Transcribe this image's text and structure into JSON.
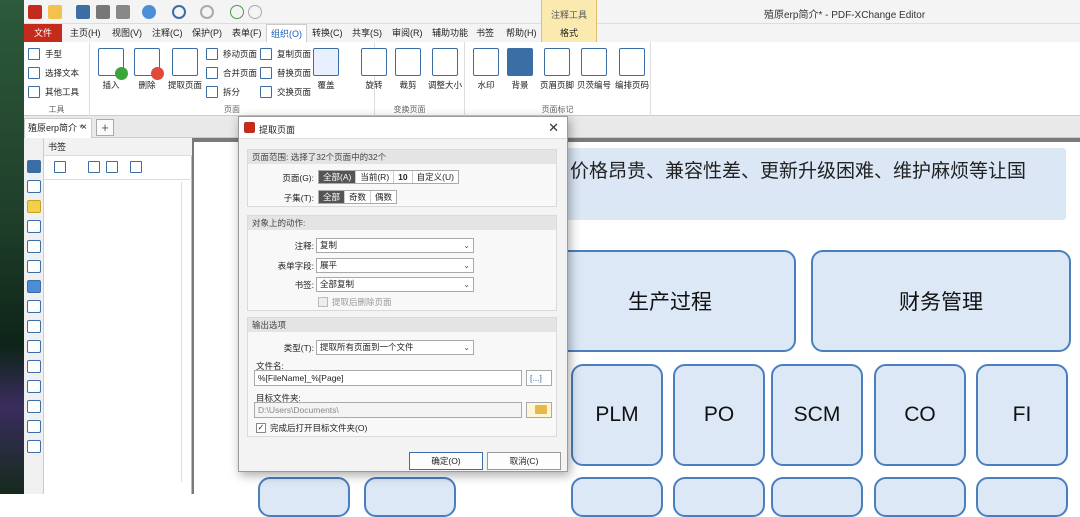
{
  "window": {
    "title": "殖原erp简介* - PDF-XChange Editor",
    "context_tool_header": "注释工具"
  },
  "menu": {
    "file": "文件",
    "tabs": [
      "主页(H)",
      "视图(V)",
      "注释(C)",
      "保护(P)",
      "表单(F)",
      "组织(O)",
      "转换(C)",
      "共享(S)",
      "审阅(R)",
      "辅助功能",
      "书签",
      "帮助(H)"
    ],
    "context_tab": "格式"
  },
  "ribbon": {
    "tools": {
      "label": "工具",
      "hand": "手型",
      "select_text": "选择文本",
      "other_tools": "其他工具"
    },
    "pages": {
      "label": "页面",
      "insert": "插入",
      "delete": "删除",
      "extract": "提取页面",
      "move": "移动页面",
      "merge": "合并页面",
      "split": "拆分",
      "copy": "复制页面",
      "replace": "替换页面",
      "swap": "交换页面",
      "cover": "覆盖"
    },
    "transform": {
      "label": "变换页面",
      "rotate": "旋转",
      "crop": "裁剪",
      "resize": "调整大小"
    },
    "marks": {
      "label": "页面标记",
      "watermark": "水印",
      "background": "背景",
      "header_footer": "页眉页脚",
      "bates": "贝茨编号",
      "number": "编排页码"
    }
  },
  "doc_tab": {
    "name": "殖原erp简介 *"
  },
  "bookmarks": {
    "title": "书签"
  },
  "document": {
    "text": "价格昂贵、兼容性差、更新升级困难、维护麻烦等让国",
    "cards_big": [
      "生产过程",
      "财务管理"
    ],
    "cards_small": [
      "PLM",
      "PO",
      "SCM",
      "CO",
      "FI"
    ]
  },
  "dialog": {
    "title": "提取页面",
    "range_header": "页面范围: 选择了32个页面中的32个",
    "pages_label": "页面(G):",
    "pages_opts": [
      "全部(A)",
      "当前(R)",
      "10",
      "自定义(U)"
    ],
    "subset_label": "子集(T):",
    "subset_opts": [
      "全部",
      "奇数",
      "偶数"
    ],
    "actions_header": "对象上的动作:",
    "annot_label": "注释:",
    "annot_value": "复制",
    "form_label": "表单字段:",
    "form_value": "展平",
    "bm_label": "书签:",
    "bm_value": "全部复制",
    "delete_after": "提取后删除页面",
    "output_header": "输出选项",
    "type_label": "类型(T):",
    "type_value": "提取所有页面到一个文件",
    "filename_label": "文件名:",
    "filename_value": "%[FileName]_%[Page]",
    "macro_btn": "[...]",
    "dest_label": "目标文件夹:",
    "dest_value": "D:\\Users\\Documents\\",
    "open_after": "完成后打开目标文件夹(O)",
    "ok": "确定(O)",
    "cancel": "取消(C)"
  }
}
